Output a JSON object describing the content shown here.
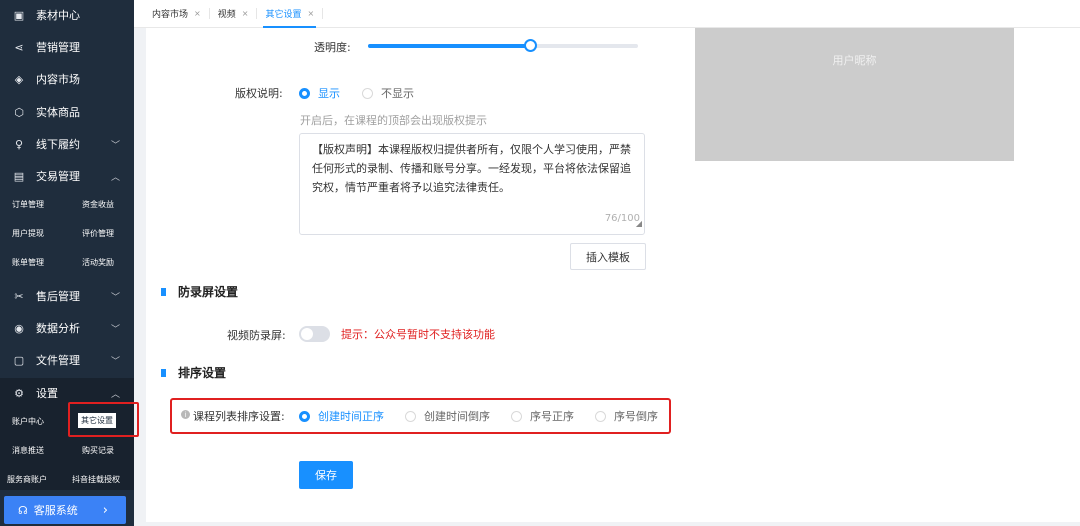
{
  "sidebar": {
    "items": [
      {
        "label": "素材中心",
        "icon": "folder-icon"
      },
      {
        "label": "营销管理",
        "icon": "share-icon"
      },
      {
        "label": "内容市场",
        "icon": "layers-icon"
      },
      {
        "label": "实体商品",
        "icon": "box-icon"
      },
      {
        "label": "线下履约",
        "icon": "user-icon"
      },
      {
        "label": "交易管理",
        "icon": "ledger-icon"
      },
      {
        "label": "售后管理",
        "icon": "tools-icon"
      },
      {
        "label": "数据分析",
        "icon": "chart-icon"
      },
      {
        "label": "文件管理",
        "icon": "file-icon"
      },
      {
        "label": "设置",
        "icon": "gear-icon"
      }
    ],
    "trade_sub": [
      "订单管理",
      "资金收益",
      "用户提现",
      "评价管理",
      "账单管理",
      "活动奖励"
    ],
    "settings_sub": [
      "账户中心",
      "其它设置",
      "消息推送",
      "购买记录",
      "服务商账户",
      "抖音挂载授权"
    ],
    "support_label": "客服系统"
  },
  "tabs": [
    {
      "label": "内容市场",
      "active": false
    },
    {
      "label": "视频",
      "active": false
    },
    {
      "label": "其它设置",
      "active": true
    }
  ],
  "form": {
    "opacity_label": "透明度:",
    "opacity_value": 0.6,
    "preview_text": "用户昵称",
    "copyright_label": "版权说明:",
    "copyright_show": "显示",
    "copyright_hide": "不显示",
    "copyright_hint": "开启后，在课程的顶部会出现版权提示",
    "copyright_text": "【版权声明】本课程版权归提供者所有，仅限个人学习使用，严禁任何形式的录制、传播和账号分享。一经发现，平台将依法保留追究权，情节严重者将予以追究法律责任。",
    "copyright_counter": "76/100",
    "insert_template": "插入模板",
    "anti_record_title": "防录屏设置",
    "video_anti_record_label": "视频防录屏:",
    "anti_record_warning": "提示：公众号暂时不支持该功能",
    "sort_title": "排序设置",
    "sort_label": "课程列表排序设置:",
    "sort_options": [
      "创建时间正序",
      "创建时间倒序",
      "序号正序",
      "序号倒序"
    ],
    "save": "保存"
  },
  "colors": {
    "accent": "#1890ff",
    "sidebar_bg": "#1f2d3d",
    "highlight_red": "#e02020"
  }
}
